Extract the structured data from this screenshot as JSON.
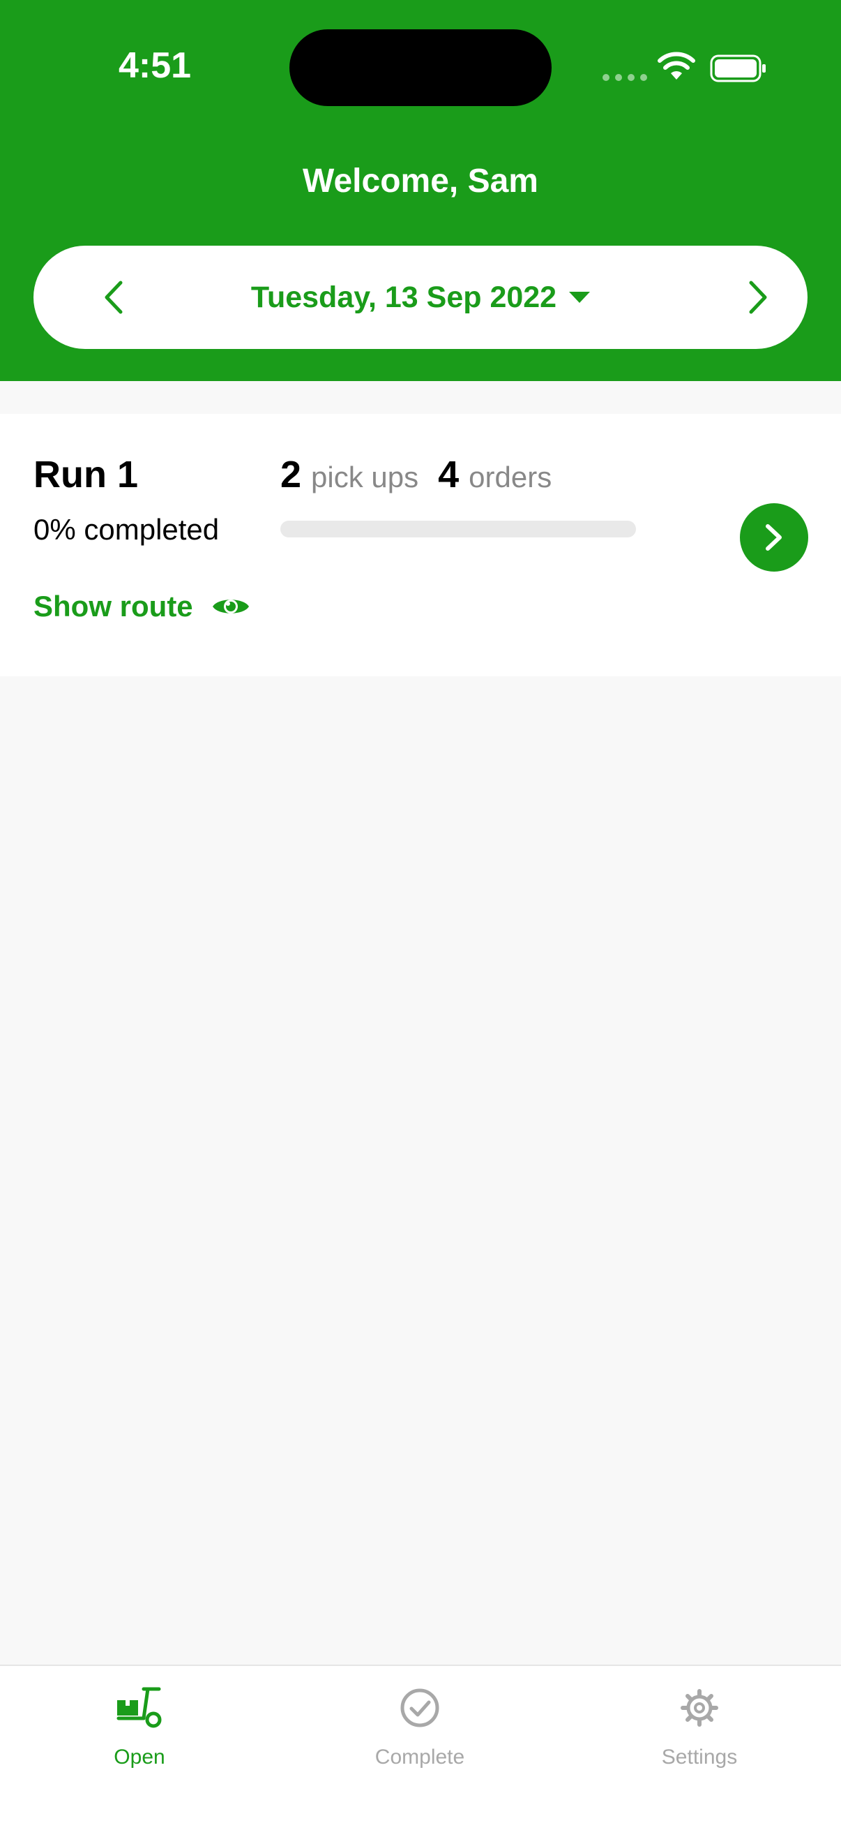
{
  "status_bar": {
    "time": "4:51"
  },
  "header": {
    "welcome": "Welcome, Sam"
  },
  "date_picker": {
    "label": "Tuesday, 13 Sep 2022"
  },
  "run": {
    "title": "Run 1",
    "completed_label": "0% completed",
    "progress_fraction": 0,
    "pickups_count": "2",
    "pickups_label": "pick ups",
    "orders_count": "4",
    "orders_label": "orders",
    "show_route_label": "Show route"
  },
  "tabs": [
    {
      "label": "Open",
      "icon": "hand-truck-icon",
      "active": true
    },
    {
      "label": "Complete",
      "icon": "check-circle-icon",
      "active": false
    },
    {
      "label": "Settings",
      "icon": "gear-icon",
      "active": false
    }
  ],
  "colors": {
    "brand": "#1a9c1a",
    "inactive_tab": "#a8a8a8",
    "background": "#f8f8f8"
  }
}
